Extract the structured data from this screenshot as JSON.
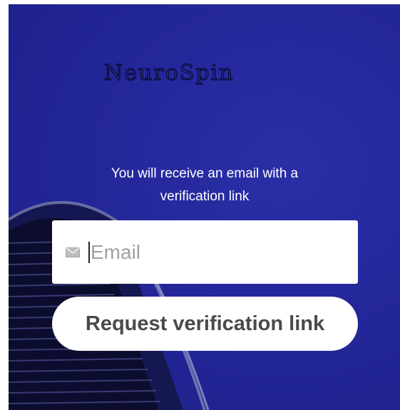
{
  "brand": {
    "logo_text": "NeuroSpin"
  },
  "form": {
    "message_line1": "You will receive an email with a",
    "message_line2": "verification link",
    "email_placeholder": "Email",
    "email_icon": "envelope-icon",
    "submit_label": "Request verification link"
  },
  "colors": {
    "background": "#24279a",
    "text_on_background": "#ffffff",
    "button_background": "#ffffff",
    "button_text": "#4a4a4a"
  }
}
